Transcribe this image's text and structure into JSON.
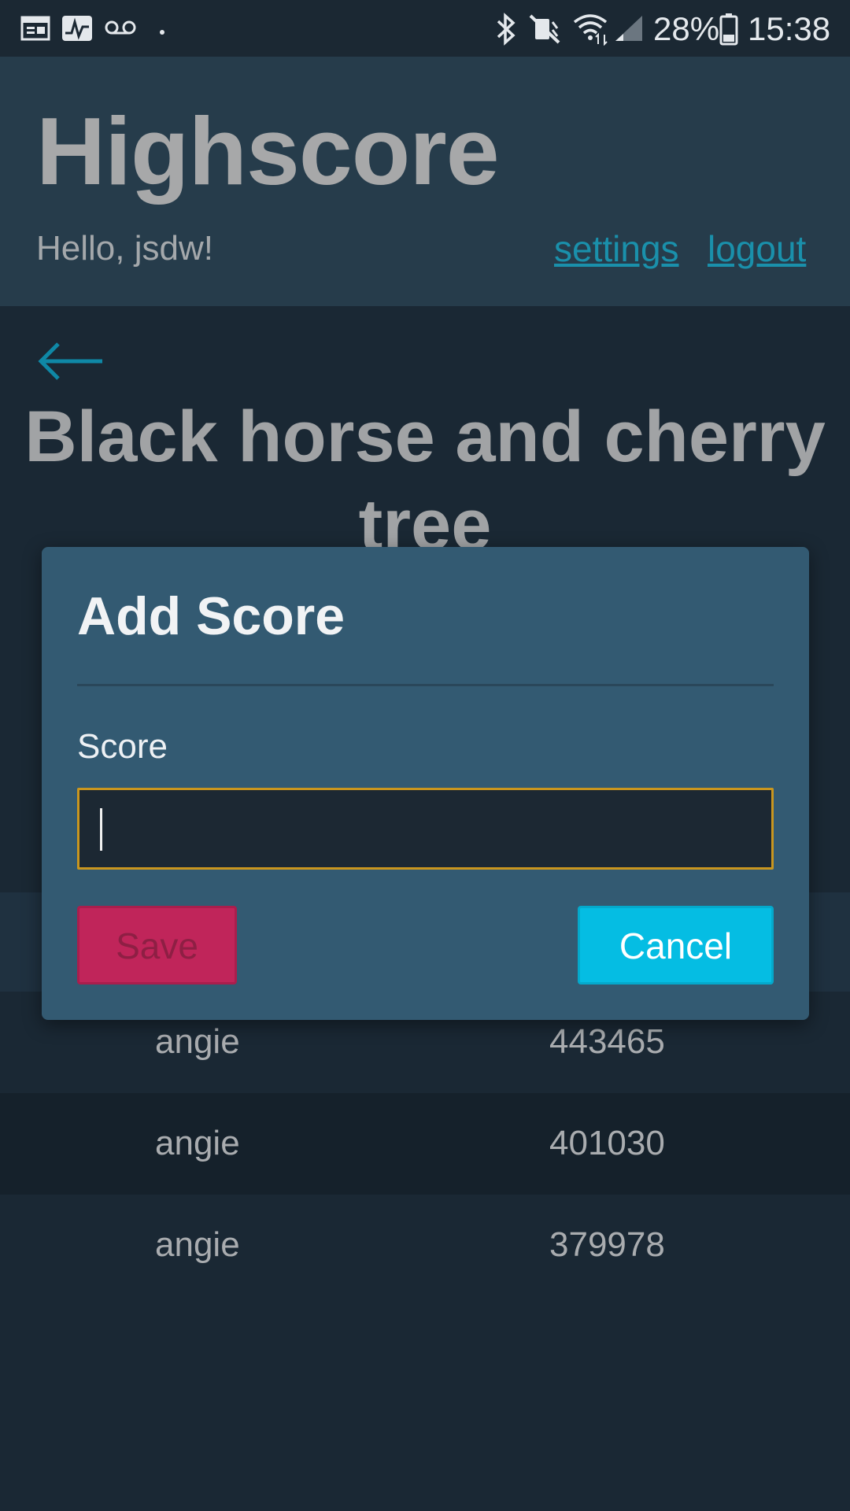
{
  "status_bar": {
    "icons": [
      "calendar-icon",
      "activity-icon",
      "voicemail-icon",
      "dot-icon",
      "bluetooth-icon",
      "mute-icon",
      "wifi-icon",
      "signal-icon",
      "battery-icon"
    ],
    "battery": "28%",
    "time": "15:38"
  },
  "header": {
    "title": "Highscore",
    "greeting": "Hello, jsdw!",
    "settings_link": "settings",
    "logout_link": "logout"
  },
  "page": {
    "back_icon": "back-arrow-icon",
    "title": "Black horse and cherry tree"
  },
  "scores": [
    {
      "name": "angie",
      "score": "443465"
    },
    {
      "name": "angie",
      "score": "401030"
    },
    {
      "name": "angie",
      "score": "379978"
    }
  ],
  "modal": {
    "title": "Add Score",
    "field_label": "Score",
    "input_value": "",
    "save_label": "Save",
    "cancel_label": "Cancel"
  },
  "colors": {
    "header_bg": "#263c4b",
    "content_bg": "#1a2834",
    "link": "#1a90ab",
    "modal_bg": "#335a72",
    "input_border": "#c9961f",
    "save_bg": "#c0255a",
    "cancel_bg": "#05bde3"
  }
}
